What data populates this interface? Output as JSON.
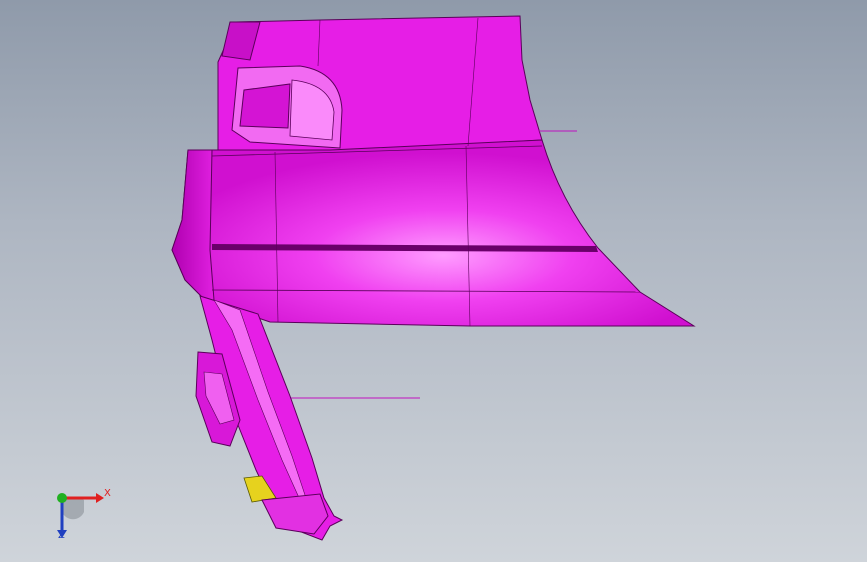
{
  "viewport": {
    "background_top": "#8f9aaa",
    "background_bottom": "#cfd4da"
  },
  "model": {
    "part_color": "#e61ee6",
    "highlight_color": "#ff9cff",
    "edge_color": "#5a005a",
    "detail_color": "#e6d21e"
  },
  "triad": {
    "x_label": "X",
    "z_label": "Z",
    "x_color": "#e02020",
    "y_color": "#20b020",
    "z_color": "#2040c0"
  }
}
